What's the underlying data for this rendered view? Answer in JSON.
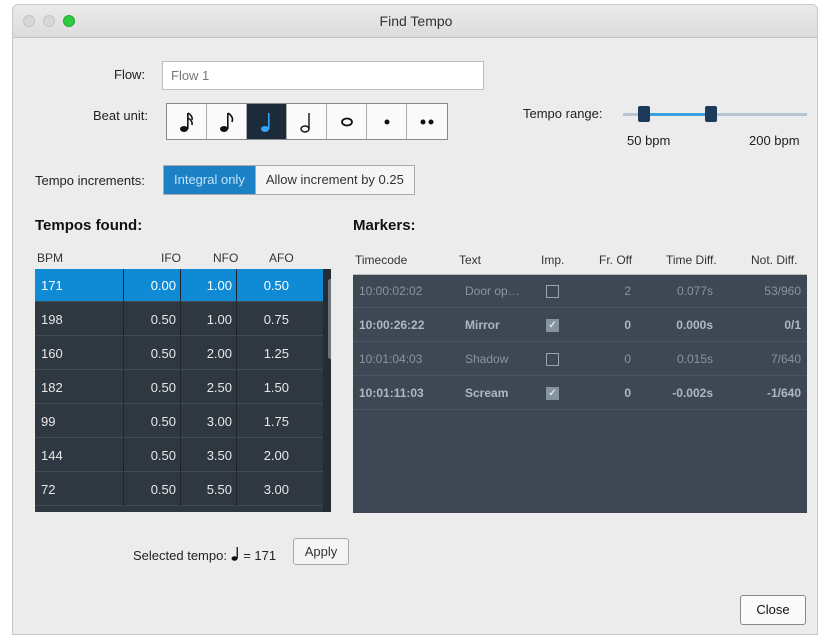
{
  "window": {
    "title": "Find Tempo"
  },
  "flow": {
    "label": "Flow:",
    "value": "Flow 1"
  },
  "beat_unit": {
    "label": "Beat unit:",
    "options": [
      {
        "name": "sixteenth-note",
        "glyph": "♬"
      },
      {
        "name": "eighth-note",
        "glyph": "♪"
      },
      {
        "name": "quarter-note",
        "glyph": "♩"
      },
      {
        "name": "half-note",
        "glyph": "𝅗𝅥"
      },
      {
        "name": "whole-note",
        "glyph": "𝅝"
      },
      {
        "name": "dot",
        "glyph": "•"
      },
      {
        "name": "double-dot",
        "glyph": "••"
      }
    ],
    "selected": "quarter-note"
  },
  "tempo_range": {
    "label": "Tempo range:",
    "min_label": "50 bpm",
    "max_label": "200 bpm"
  },
  "tempo_increments": {
    "label": "Tempo increments:",
    "options": [
      "Integral only",
      "Allow increment by 0.25"
    ],
    "selected": "Integral only"
  },
  "tempos_found": {
    "title": "Tempos found:",
    "columns": [
      "BPM",
      "IFO",
      "NFO",
      "AFO"
    ],
    "rows": [
      [
        "171",
        "0.00",
        "1.00",
        "0.50"
      ],
      [
        "198",
        "0.50",
        "1.00",
        "0.75"
      ],
      [
        "160",
        "0.50",
        "2.00",
        "1.25"
      ],
      [
        "182",
        "0.50",
        "2.50",
        "1.50"
      ],
      [
        "99",
        "0.50",
        "3.00",
        "1.75"
      ],
      [
        "144",
        "0.50",
        "3.50",
        "2.00"
      ],
      [
        "72",
        "0.50",
        "5.50",
        "3.00"
      ]
    ],
    "selected_row": 0
  },
  "markers": {
    "title": "Markers:",
    "columns": [
      "Timecode",
      "Text",
      "Imp.",
      "Fr. Off",
      "Time Diff.",
      "Not. Diff."
    ],
    "rows": [
      {
        "timecode": "10:00:02:02",
        "text": "Door op…",
        "important": false,
        "fr_off": "2",
        "time_diff": "0.077s",
        "not_diff": "53/960"
      },
      {
        "timecode": "10:00:26:22",
        "text": "Mirror",
        "important": true,
        "fr_off": "0",
        "time_diff": "0.000s",
        "not_diff": "0/1"
      },
      {
        "timecode": "10:01:04:03",
        "text": "Shadow",
        "important": false,
        "fr_off": "0",
        "time_diff": "0.015s",
        "not_diff": "7/640"
      },
      {
        "timecode": "10:01:11:03",
        "text": "Scream",
        "important": true,
        "fr_off": "0",
        "time_diff": "-0.002s",
        "not_diff": "-1/640"
      }
    ]
  },
  "selected_tempo": {
    "label": "Selected tempo:",
    "value": "= 171"
  },
  "buttons": {
    "apply": "Apply",
    "close": "Close"
  },
  "colors": {
    "accent": "#0f8bd6",
    "table_bg": "#2f3741",
    "markers_bg": "#3e4854",
    "selected_beat_bg": "#1c2a3a"
  }
}
